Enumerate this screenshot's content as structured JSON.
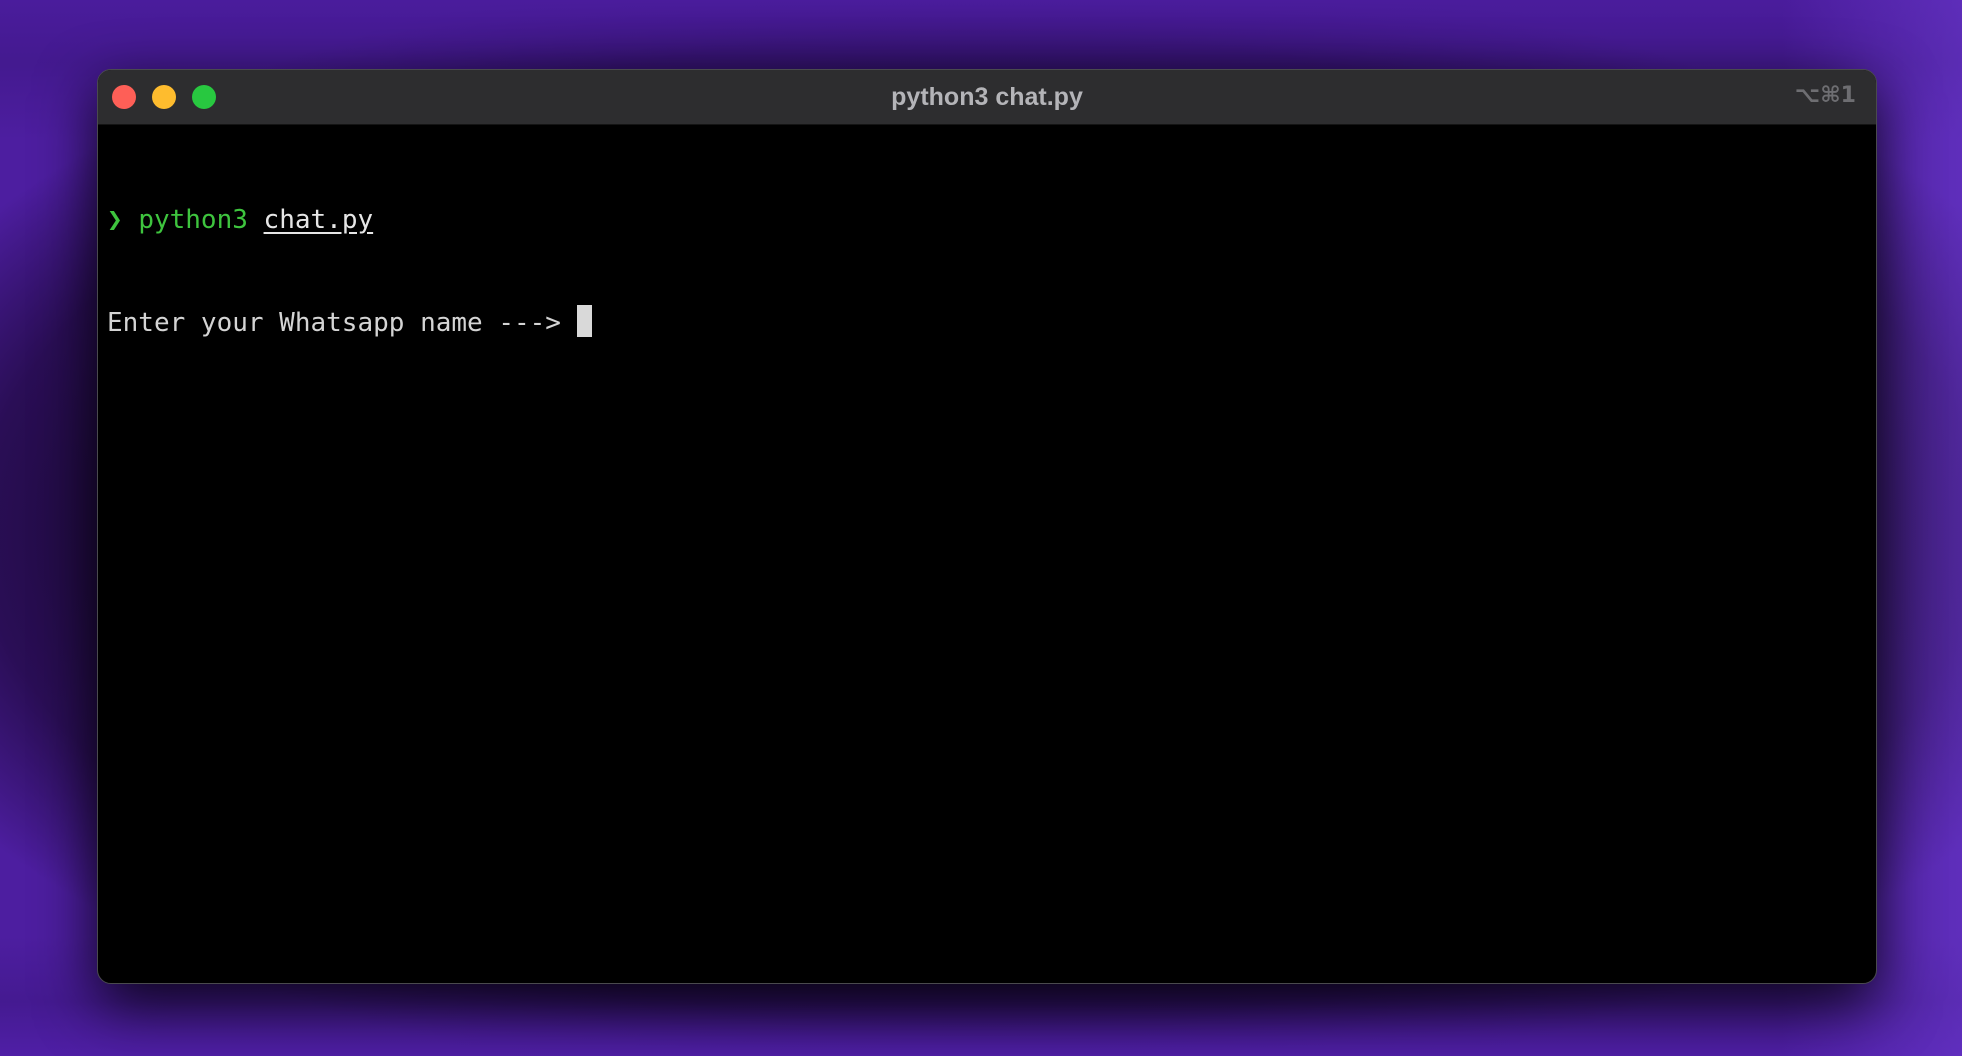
{
  "window": {
    "title": "python3 chat.py",
    "shortcut": "⌥⌘1"
  },
  "terminal": {
    "prompt_symbol": "❯",
    "command": "python3",
    "argument": "chat.py",
    "output_line": "Enter your Whatsapp name ---> "
  },
  "icons": {
    "close": "close-traffic-light-icon",
    "minimize": "minimize-traffic-light-icon",
    "zoom": "zoom-traffic-light-icon"
  },
  "colors": {
    "close": "#fe5f57",
    "minimize": "#febc2e",
    "zoom": "#28c840",
    "prompt_green": "#3ec43e",
    "terminal_bg": "#000000"
  }
}
